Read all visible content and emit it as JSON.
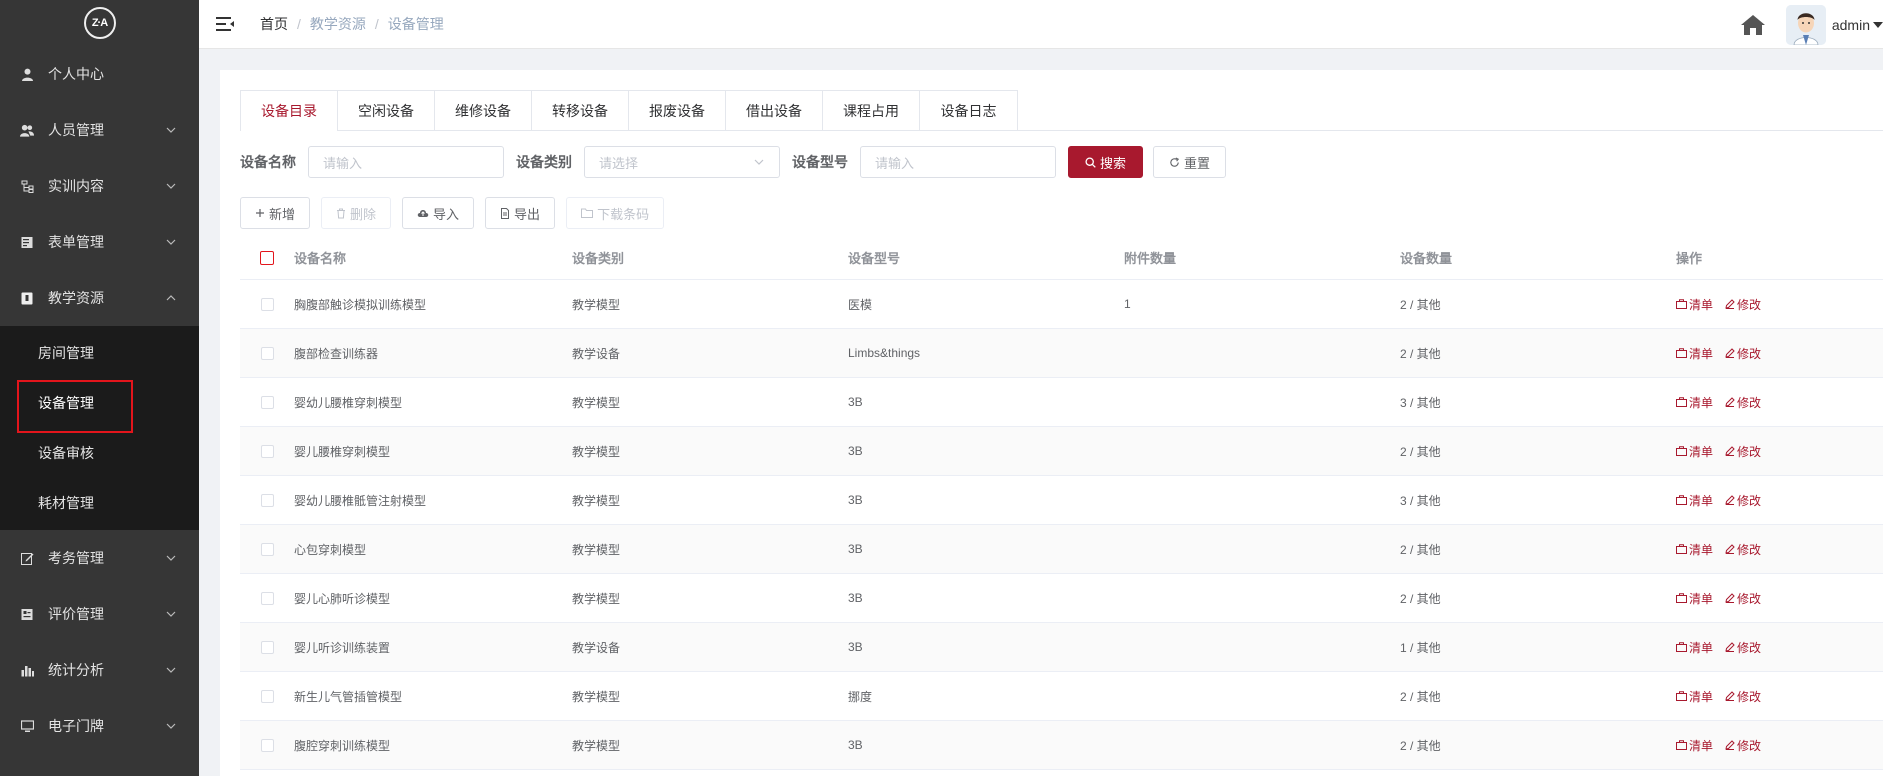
{
  "sidebar": {
    "logo_text": "Z·A",
    "items": [
      {
        "label": "个人中心",
        "icon": "user-icon"
      },
      {
        "label": "人员管理",
        "icon": "users-icon"
      },
      {
        "label": "实训内容",
        "icon": "tree-icon"
      },
      {
        "label": "表单管理",
        "icon": "form-icon"
      },
      {
        "label": "教学资源",
        "icon": "book-icon"
      },
      {
        "label": "考务管理",
        "icon": "edit-icon"
      },
      {
        "label": "评价管理",
        "icon": "rating-icon"
      },
      {
        "label": "统计分析",
        "icon": "chart-icon"
      },
      {
        "label": "电子门牌",
        "icon": "monitor-icon"
      }
    ],
    "submenu": [
      {
        "label": "房间管理"
      },
      {
        "label": "设备管理"
      },
      {
        "label": "设备审核"
      },
      {
        "label": "耗材管理"
      }
    ]
  },
  "header": {
    "breadcrumb": [
      "首页",
      "教学资源",
      "设备管理"
    ],
    "separator": "/",
    "username": "admin"
  },
  "tabs": [
    "设备目录",
    "空闲设备",
    "维修设备",
    "转移设备",
    "报废设备",
    "借出设备",
    "课程占用",
    "设备日志"
  ],
  "filter": {
    "name_label": "设备名称",
    "name_placeholder": "请输入",
    "type_label": "设备类别",
    "type_placeholder": "请选择",
    "model_label": "设备型号",
    "model_placeholder": "请输入",
    "search_label": "搜索",
    "reset_label": "重置"
  },
  "toolbar": {
    "add": "新增",
    "delete": "删除",
    "import": "导入",
    "export": "导出",
    "download": "下载条码"
  },
  "table": {
    "headers": {
      "name": "设备名称",
      "type": "设备类别",
      "model": "设备型号",
      "attachments": "附件数量",
      "quantity": "设备数量",
      "actions": "操作"
    },
    "op_list": "清单",
    "op_edit": "修改",
    "rows": [
      {
        "name": "胸腹部触诊模拟训练模型",
        "type": "教学模型",
        "model": "医模",
        "attachments": "1",
        "quantity": "2 / 其他"
      },
      {
        "name": "腹部检查训练器",
        "type": "教学设备",
        "model": "Limbs&things",
        "attachments": "",
        "quantity": "2 / 其他"
      },
      {
        "name": "婴幼儿腰椎穿刺模型",
        "type": "教学模型",
        "model": "3B",
        "attachments": "",
        "quantity": "3 / 其他"
      },
      {
        "name": "婴儿腰椎穿刺模型",
        "type": "教学模型",
        "model": "3B",
        "attachments": "",
        "quantity": "2 / 其他"
      },
      {
        "name": "婴幼儿腰椎骶管注射模型",
        "type": "教学模型",
        "model": "3B",
        "attachments": "",
        "quantity": "3 / 其他"
      },
      {
        "name": "心包穿刺模型",
        "type": "教学模型",
        "model": "3B",
        "attachments": "",
        "quantity": "2 / 其他"
      },
      {
        "name": "婴儿心肺听诊模型",
        "type": "教学模型",
        "model": "3B",
        "attachments": "",
        "quantity": "2 / 其他"
      },
      {
        "name": "婴儿听诊训练装置",
        "type": "教学设备",
        "model": "3B",
        "attachments": "",
        "quantity": "1 / 其他"
      },
      {
        "name": "新生儿气管插管模型",
        "type": "教学模型",
        "model": "挪度",
        "attachments": "",
        "quantity": "2 / 其他"
      },
      {
        "name": "腹腔穿刺训练模型",
        "type": "教学模型",
        "model": "3B",
        "attachments": "",
        "quantity": "2 / 其他"
      }
    ]
  },
  "colors": {
    "primary": "#a8192e",
    "sidebar_bg": "#363636",
    "submenu_bg": "#1b1b1b",
    "highlight_box": "#e3151c"
  }
}
